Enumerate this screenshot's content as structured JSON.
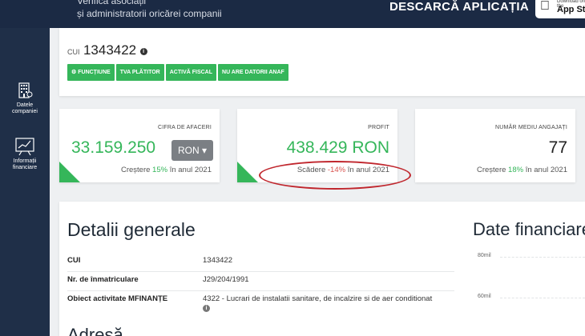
{
  "header": {
    "tagline_line1": "Verifică asociații",
    "tagline_line2": "și administratorii oricărei companii",
    "download_label": "DESCARCĂ APLICAȚIA",
    "store_small": "Download on the",
    "store_big": "App St"
  },
  "sidebar": {
    "items": [
      {
        "label_line1": "Datele",
        "label_line2": "companiei",
        "icon": "building-icon"
      },
      {
        "label_line1": "Informații",
        "label_line2": "financiare",
        "icon": "chart-icon"
      }
    ]
  },
  "company": {
    "cui_prefix": "CUI",
    "cui": "1343422",
    "badges": [
      "FUNCȚIUNE",
      "TVA PLĂTITOR",
      "ACTIVĂ FISCAL",
      "NU ARE DATORII ANAF"
    ]
  },
  "stats": {
    "turnover": {
      "title": "CIFRA DE AFACERI",
      "value": "33.159.250",
      "currency_button": "RON ▾",
      "sub_prefix": "Creștere",
      "sub_pct": "15%",
      "sub_suffix": "în anul 2021"
    },
    "profit": {
      "title": "PROFIT",
      "value": "438.429 RON",
      "sub_prefix": "Scădere",
      "sub_pct": "-14%",
      "sub_suffix": "în anul 2021"
    },
    "employees": {
      "title": "NUMĂR MEDIU ANGAJAȚI",
      "value": "77",
      "sub_prefix": "Creștere",
      "sub_pct": "18%",
      "sub_suffix": "în anul 2021"
    }
  },
  "details": {
    "title": "Detalii generale",
    "rows": [
      {
        "key": "CUI",
        "value": "1343422"
      },
      {
        "key": "Nr. de înmatriculare",
        "value": "J29/204/1991"
      },
      {
        "key": "Obiect activitate MFINANȚE",
        "value": "4322 - Lucrari de instalatii sanitare, de incalzire si de aer conditionat"
      }
    ],
    "next_heading": "Adresă"
  },
  "financial": {
    "title": "Date financiare",
    "grid_labels": [
      "80mil",
      "60mil"
    ]
  },
  "colors": {
    "accent_green": "#35b65a",
    "header_navy": "#1b2a44",
    "decrease_red": "#d9534f",
    "annotation_red": "#c0262d"
  }
}
